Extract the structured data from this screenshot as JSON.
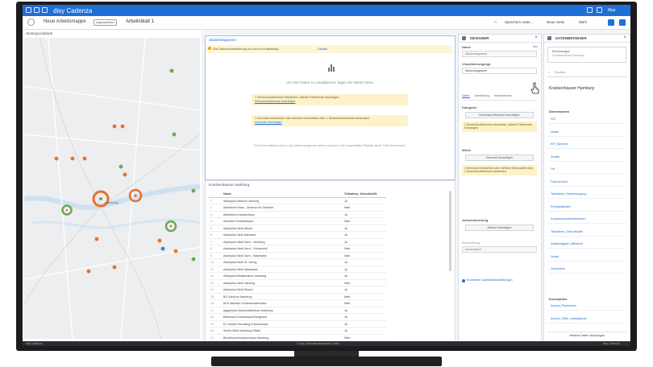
{
  "app": {
    "brand": "disy Cadenza",
    "user": "Max"
  },
  "toolbar": {
    "project": "Neue Arbeitsmappe",
    "badge": "ungespeichert",
    "sheet": "Arbeitsblatt 1",
    "save_label": "Speichern unter...",
    "new_sheet_label": "Neue Seite",
    "more_label": "Mehr"
  },
  "map": {
    "title": "Hintergrundkarte",
    "city_label": "Hamburg"
  },
  "chart": {
    "title": "Säulendiagramm",
    "warning": "Die Datenvisualisierung ist noch unvollständig.",
    "warning_link": "Details",
    "empty_msg": "Um Ihre Daten zu visualisieren, fügen Sie Werte hinzu",
    "hints": [
      {
        "text": "1 Dimension/Merkmal erforderlich, aktuell 0 Merkmale hinzufügen.",
        "link": "Dimension/Merkmal hinzufügen"
      },
      {
        "text": "1 Kennzahl erforderlich oder mehrere Kennzahlen über 1 Dimension/Merkmal verwenden.",
        "link": "Kennzahl hinzufügen"
      }
    ],
    "footnote": "Sie können Attribute auch in das Datenmanagement ziehen und dann in die ausgewählten Register dieser Seite übernehmen."
  },
  "table": {
    "title": "Krankenhäuser Hamburg",
    "col_name": "Name",
    "col_flag": "Teilnahme_Geburtshilfe",
    "rows": [
      [
        "1",
        "Asklepios Klinikum Harburg",
        "Ja"
      ],
      [
        "2",
        "Albertinen-Haus - Zentrum für Geriatrie",
        "Nein"
      ],
      [
        "3",
        "Albertinen-Krankenhaus",
        "Ja"
      ],
      [
        "4",
        "Alexianer Krankenhaus",
        "Nein"
      ],
      [
        "5",
        "Asklepios Klinik Altona",
        "Ja"
      ],
      [
        "6",
        "Asklepios Klinik Barmbek",
        "Ja"
      ],
      [
        "7",
        "Asklepios Klinik Nord - Heidberg",
        "Ja"
      ],
      [
        "8",
        "Asklepios Klinik Nord - Ochsenzoll",
        "Nein"
      ],
      [
        "9",
        "Asklepios Klinik Nord - Wandsbek",
        "Nein"
      ],
      [
        "10",
        "Asklepios Klinik St. Georg",
        "Ja"
      ],
      [
        "11",
        "Asklepios Klinik Wandsbek",
        "Ja"
      ],
      [
        "12",
        "Asklepios Westklinikum Hamburg",
        "Ja"
      ],
      [
        "13",
        "Asklepios Klinik Harburg",
        "Nein"
      ],
      [
        "14",
        "Asklepios Klinik Rissen",
        "Ja"
      ],
      [
        "15",
        "BG Klinikum Hamburg",
        "Nein"
      ],
      [
        "16",
        "AKK Altonaer Kinderkrankenhaus",
        "Nein"
      ],
      [
        "17",
        "Agaplesion Diakonieklinikum Hamburg",
        "Ja"
      ],
      [
        "18",
        "Bethesda Krankenhaus Bergedorf",
        "Ja"
      ],
      [
        "19",
        "Ev. Amalie Sieveking Krankenhaus",
        "Ja"
      ],
      [
        "20",
        "Schön Klinik Hamburg Eilbek",
        "Ja"
      ],
      [
        "21",
        "Bundeswehrkrankenhaus Hamburg",
        "Nein"
      ],
      [
        "22",
        "Kath. Marienkrankenhaus",
        "Nein"
      ],
      [
        "23",
        "Krankenhaus Jerusalem",
        "Nein"
      ]
    ]
  },
  "designer": {
    "title": "DESIGNER",
    "name_label": "Name",
    "name_required": "leer",
    "name_placeholder": "Säulendiagramm",
    "vis_label": "Visualisierungstyp",
    "vis_value": "Säulendiagramm",
    "tabs": [
      "Daten",
      "Darstellung",
      "Informationen"
    ],
    "category_label": "Kategorie",
    "category_btn": "Dimension/Merkmal hinzufügen",
    "category_warn": "1 Dimension/Merkmal erforderlich, aktuell 0 Merkmale hinzufügen.",
    "values_label": "Werte",
    "values_btn": "Kennzahl hinzufügen",
    "values_warn": "1 Kennzahl erforderlich oder mehrere Kennzahlen über 1 Dimension/Merkmal verwenden.",
    "split_label": "Aufschlüsselung",
    "split_btn": "Attribut hinzufügen",
    "extra_label": "Beschriftung",
    "extra_value": "Automatisch",
    "link": "Erweiterte Datenfeldeinstellungen"
  },
  "browser": {
    "title": "DATENBROWSER",
    "source_line1": "Einrichtungen",
    "source_line2": "Krankenhäuser Hamburg",
    "search_placeholder": "Suchen",
    "dataset_title": "Krankenhäuser Hamburg",
    "dimensions_label": "Dimensionen",
    "fields": [
      "FID",
      "Name",
      "KH_Nummer",
      "Straße",
      "Ort",
      "Fachbereich",
      "Teilnahme_Notversorgung",
      "Privatpatienten",
      "Krankenhausbetriebsform",
      "Teilnahme_Geburtshilfe",
      "Zuständigkeit_öffentlich",
      "Stand",
      "Geometrie"
    ],
    "measures_label": "Kennzahlen",
    "measures": [
      "Anzahl_Planbetten",
      "Anzahl_Fälle_Vollstationär"
    ],
    "add_btn": "Weitere Daten hinzufügen"
  },
  "status": {
    "left": "disy Cadenza",
    "center": "© Disy Informationssysteme GmbH",
    "right": "disy Cadenza"
  },
  "colors": {
    "accent": "#1f6fd6",
    "warn_bg": "#fdf2c9",
    "orange": "#e8702a",
    "green": "#6aa84f"
  }
}
